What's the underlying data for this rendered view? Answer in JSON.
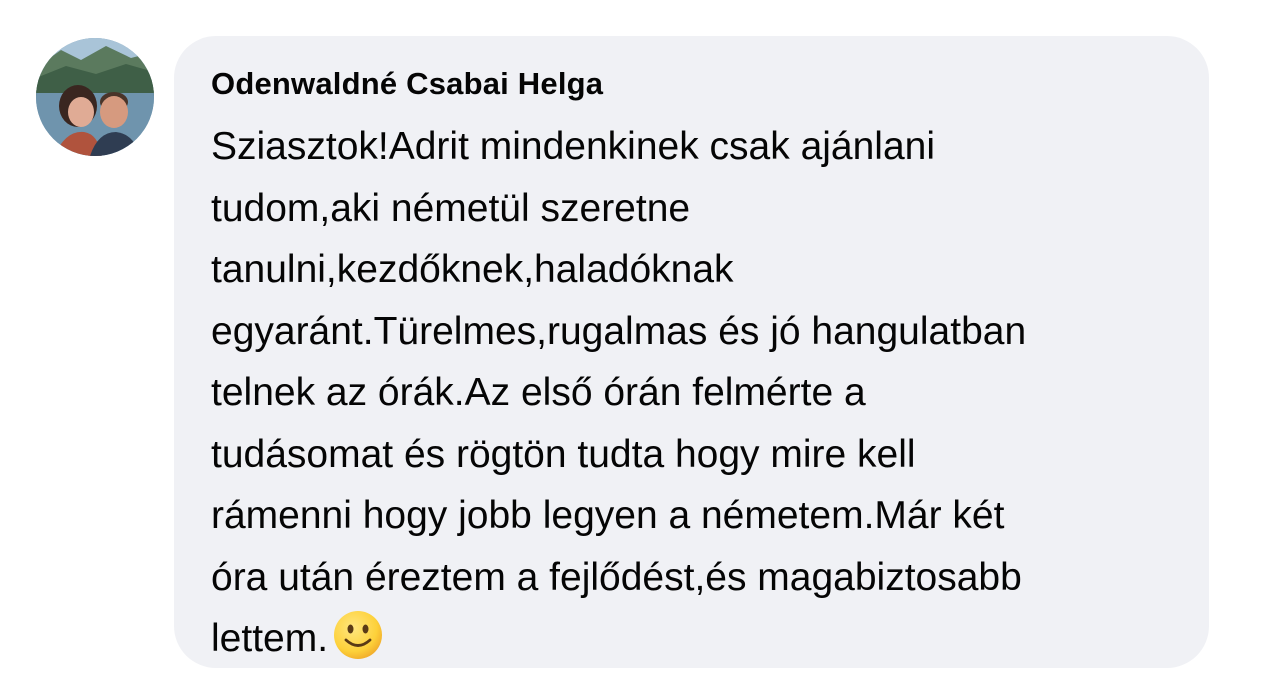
{
  "comment": {
    "author": "Odenwaldné Csabai Helga",
    "avatar_icon": "profile-photo-couple-lake",
    "lines": [
      "Sziasztok!Adrit mindenkinek csak ajánlani",
      "tudom,aki németül szeretne",
      "tanulni,kezdőknek,haladóknak",
      "egyaránt.Türelmes,rugalmas és jó hangulatban",
      "telnek az órák.Az első órán felmérte a",
      "tudásomat és rögtön tudta hogy mire kell",
      "rámenni hogy jobb legyen a németem.Már két",
      "óra után éreztem a fejlődést,és magabiztosabb",
      "lettem."
    ],
    "emoji": "slightly-smiling-face-icon"
  },
  "colors": {
    "bubble_bg": "#f0f1f5",
    "text": "#050505",
    "emoji_face": "#fdd13a"
  }
}
